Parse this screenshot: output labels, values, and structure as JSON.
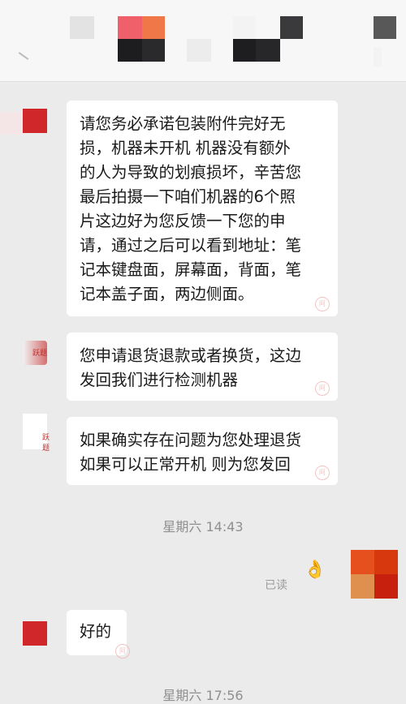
{
  "header": {
    "pixel_colors": [
      "#e3e3e3",
      "#f0606a",
      "#f07848",
      "#1d1d1f",
      "#2a2a2c",
      "#ececec",
      "#d9d9d9",
      "#3a3a3c",
      "#585858",
      "#1e1e20",
      "#272729"
    ]
  },
  "messages": [
    {
      "side": "left",
      "text": "请您务必承诺包装附件完好无\n损，机器未开机 机器没有额外\n的人为导致的划痕损坏，辛苦您\n最后拍摄一下咱们机器的6个照\n片这边好为您反馈一下您的申\n请，通过之后可以看到地址：笔\n记本键盘面，屏幕面，背面，笔\n记本盖子面，两边侧面。"
    },
    {
      "side": "left",
      "avatar_label": "跃题",
      "text": "您申请退货退款或者换货，这边\n发回我们进行检测机器"
    },
    {
      "side": "left",
      "avatar_label": "跃题",
      "text": "如果确实存在问题为您处理退货\n如果可以正常开机 则为您发回"
    },
    {
      "side": "left",
      "text": "好的"
    }
  ],
  "timestamps": [
    "星期六 14:43",
    "星期六 17:56"
  ],
  "read_receipt": "已读",
  "sticker": "👌",
  "colors": {
    "background": "#ebebeb",
    "bubble": "#ffffff",
    "avatar_red": "#d0282a",
    "timestamp": "#8f8f8f"
  }
}
